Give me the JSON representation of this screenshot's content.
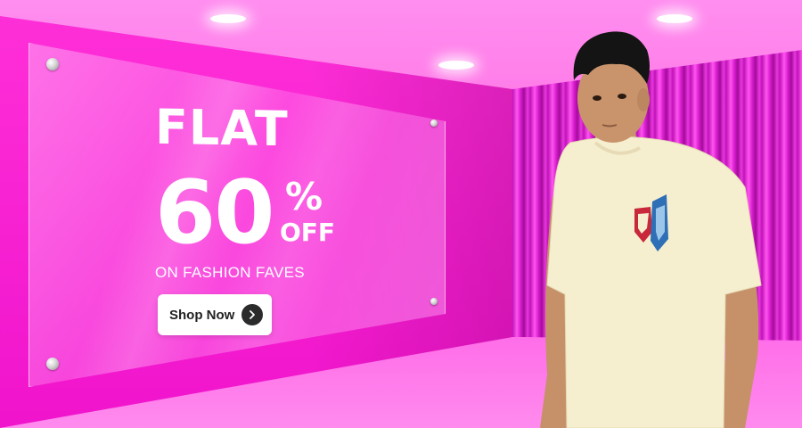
{
  "banner": {
    "headline": "FLAT",
    "discount_number": "60",
    "percent_sign": "%",
    "off_text": "OFF",
    "subheading": "ON FASHION FAVES",
    "cta_label": "Shop Now"
  },
  "icons": {
    "cta_icon": "chevron-right-icon",
    "shirt_graphic": "robot-emblem-icon"
  },
  "colors": {
    "wall_magenta": "#f014cc",
    "curtain_purple": "#c013b8",
    "ceiling_pink": "#ff8ef0",
    "text_white": "#ffffff",
    "button_white": "#ffffff",
    "button_icon_dark": "#2b2b2b",
    "tshirt_cream": "#f6efcf"
  }
}
